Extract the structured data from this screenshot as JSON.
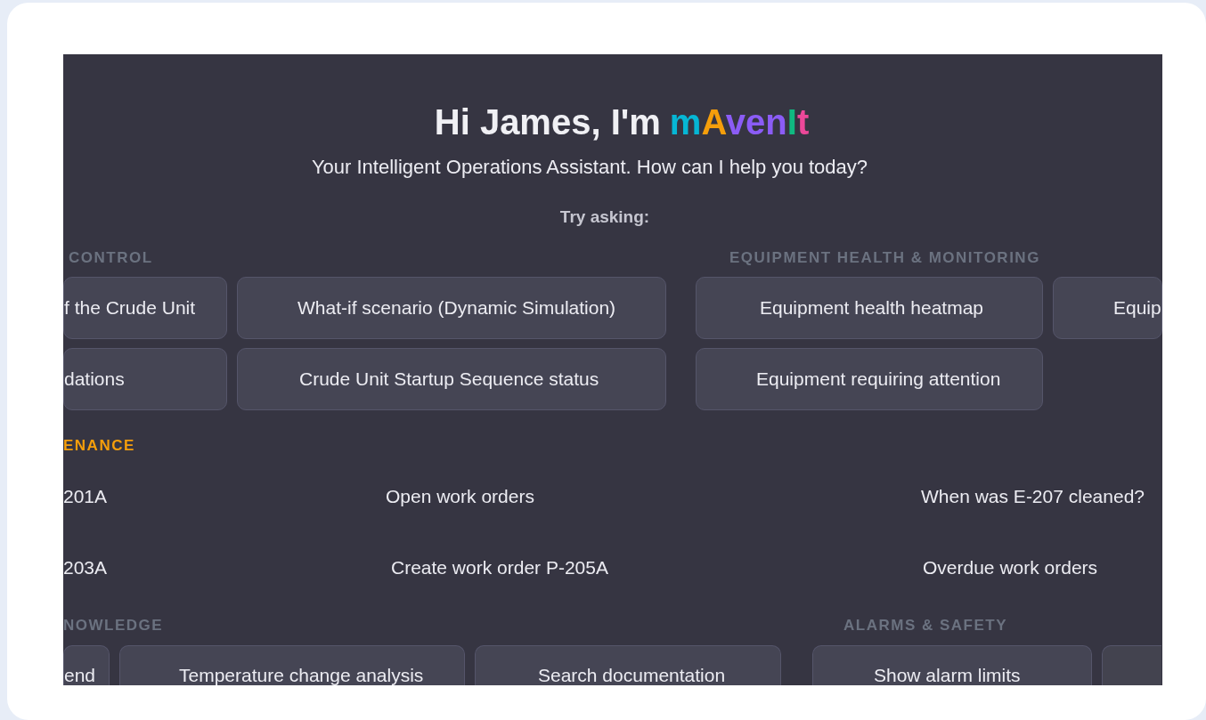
{
  "greeting": {
    "text": "Hi James, I'm",
    "brand": [
      {
        "text": "m",
        "color": "#06b6d4"
      },
      {
        "text": "A",
        "color": "#f59e0b"
      },
      {
        "text": "ven",
        "color": "#8b5cf6"
      },
      {
        "text": "I",
        "color": "#10b981"
      },
      {
        "text": "t",
        "color": "#ec4899"
      }
    ]
  },
  "subtitle": "Your Intelligent Operations Assistant. How can I help you today?",
  "prompt_label": "Try asking:",
  "bands": [
    {
      "sections": [
        {
          "title": "CONTROL",
          "active": false,
          "items": [
            {
              "kind": "chip",
              "text": "f the Crude Unit"
            },
            {
              "kind": "chip",
              "text": "What-if scenario (Dynamic Simulation)"
            },
            {
              "kind": "chip",
              "text": "dations"
            },
            {
              "kind": "chip",
              "text": "Crude Unit Startup Sequence status"
            }
          ]
        },
        {
          "title": "EQUIPMENT HEALTH & MONITORING",
          "active": false,
          "items": [
            {
              "kind": "chip",
              "text": "Equipment health heatmap"
            },
            {
              "kind": "chip",
              "text": "Equip"
            },
            {
              "kind": "chip",
              "text": "Equipment requiring attention"
            }
          ]
        }
      ]
    },
    {
      "sections": [
        {
          "title": "ENANCE",
          "active": true,
          "items": [
            {
              "kind": "link",
              "text": "201A"
            },
            {
              "kind": "link",
              "text": "Open work orders"
            },
            {
              "kind": "link",
              "text": "When was E-207 cleaned?"
            },
            {
              "kind": "link",
              "text": "203A"
            },
            {
              "kind": "link",
              "text": "Create work order P-205A"
            },
            {
              "kind": "link",
              "text": "Overdue work orders"
            }
          ]
        }
      ]
    },
    {
      "sections": [
        {
          "title": "NOWLEDGE",
          "active": false,
          "items": [
            {
              "kind": "chip",
              "text": "end"
            },
            {
              "kind": "chip",
              "text": "Temperature change analysis"
            },
            {
              "kind": "chip",
              "text": "Search documentation"
            }
          ]
        },
        {
          "title": "ALARMS & SAFETY",
          "active": false,
          "items": [
            {
              "kind": "chip",
              "text": "Show alarm limits"
            },
            {
              "kind": "clipped"
            }
          ]
        }
      ]
    }
  ]
}
